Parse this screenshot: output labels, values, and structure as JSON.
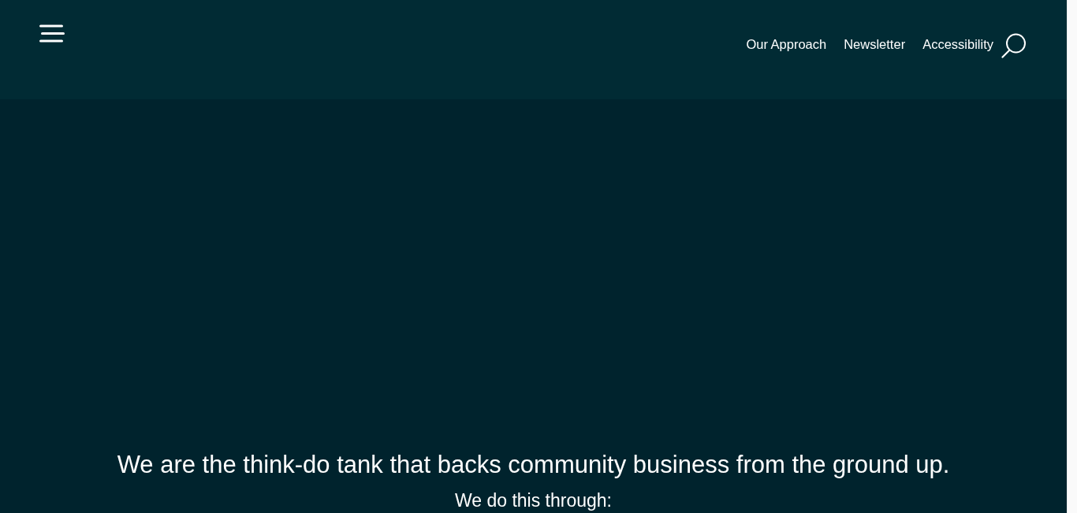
{
  "header": {
    "nav_links": [
      {
        "label": "Our Approach"
      },
      {
        "label": "Newsletter"
      },
      {
        "label": "Accessibility"
      }
    ]
  },
  "hero": {
    "headline": "We are the think-do tank that backs community business from the ground up.",
    "subheading": "We do this through:"
  }
}
